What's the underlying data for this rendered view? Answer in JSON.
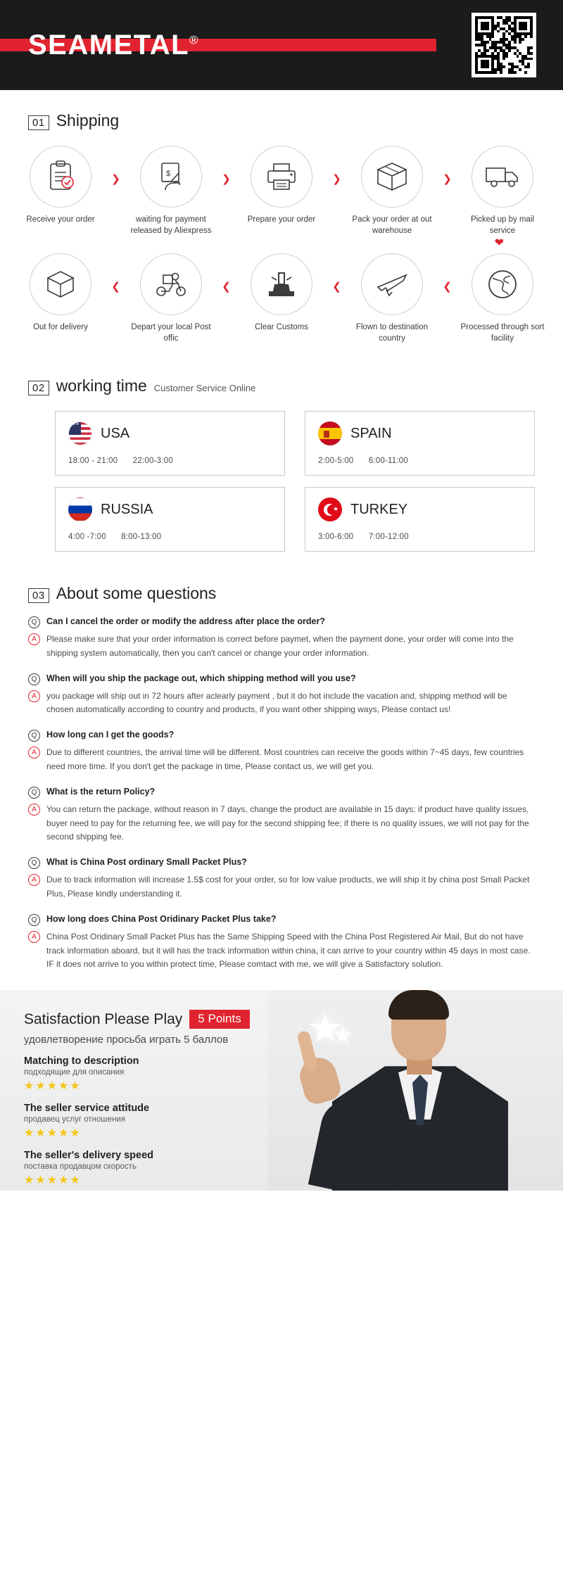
{
  "header": {
    "brand": "SEAMETAL",
    "registered_mark": "®",
    "qr_label": "qr-code"
  },
  "sections": {
    "shipping": {
      "number": "01",
      "title": "Shipping"
    },
    "working_time": {
      "number": "02",
      "title": "working time",
      "subtitle": "Customer Service Online"
    },
    "faq": {
      "number": "03",
      "title": "About some questions"
    }
  },
  "shipping_steps_row1": [
    {
      "icon": "clipboard-check-icon",
      "label": "Receive your order"
    },
    {
      "icon": "payment-hand-icon",
      "label": "waiting for payment released by Aliexpress"
    },
    {
      "icon": "printer-icon",
      "label": "Prepare your order"
    },
    {
      "icon": "box-icon",
      "label": "Pack your order at out warehouse"
    },
    {
      "icon": "truck-icon",
      "label": "Picked up by mail service"
    }
  ],
  "shipping_steps_row2": [
    {
      "icon": "open-box-icon",
      "label": "Out  for delivery"
    },
    {
      "icon": "scooter-delivery-icon",
      "label": "Depart your local Post offic"
    },
    {
      "icon": "customs-stamp-icon",
      "label": "Clear Customs"
    },
    {
      "icon": "airplane-icon",
      "label": "Flown to destination country"
    },
    {
      "icon": "globe-icon",
      "label": "Processed through sort facility"
    }
  ],
  "working_time_cards": [
    {
      "flag": "flag-usa-icon",
      "country": "USA",
      "times": [
        "18:00 - 21:00",
        "22:00-3:00"
      ]
    },
    {
      "flag": "flag-spain-icon",
      "country": "SPAIN",
      "times": [
        "2:00-5:00",
        "6:00-11:00"
      ]
    },
    {
      "flag": "flag-russia-icon",
      "country": "RUSSIA",
      "times": [
        "4:00 -7:00",
        "8:00-13:00"
      ]
    },
    {
      "flag": "flag-turkey-icon",
      "country": "TURKEY",
      "times": [
        "3:00-6:00",
        "7:00-12:00"
      ]
    }
  ],
  "faq": [
    {
      "q_badge": "Q",
      "a_badge": "A",
      "question": "Can I cancel the order or modify the address after place the order?",
      "answer": "Please make sure that your order information is correct before paymet, when the payment done, your order will come into the shipping system automatically, then you can't cancel or change your order information."
    },
    {
      "q_badge": "Q",
      "a_badge": "A",
      "question": "When will you ship the package out, which shipping method will you use?",
      "answer": "you package will ship out in 72 hours after aclearly payment , but it do hot include the vacation and, shipping method will be chosen automatically according to country and products, if you want other shipping ways, Please contact us!"
    },
    {
      "q_badge": "Q",
      "a_badge": "A",
      "question": "How long can I get the goods?",
      "answer": "Due to different countries, the arrival time will be different. Most countries can receive the goods within 7~45 days, few countries need more time. If you don't get the package in time, Please contact us, we will get you."
    },
    {
      "q_badge": "Q",
      "a_badge": "A",
      "question": "What is the return Policy?",
      "answer": "You can return the package, without reason in 7 days, change the product are available in 15 days; if product have quality issues, buyer need to pay for the returning fee, we will pay for the second shipping fee; if there is no quality issues, we will not pay for the second shipping fee."
    },
    {
      "q_badge": "Q",
      "a_badge": "A",
      "question": "What is China Post ordinary Small Packet Plus?",
      "answer": "Due to track information will increase 1.5$ cost for your order, so for low value products, we will ship it by china post Small Packet Plus, Please kindly understanding it."
    },
    {
      "q_badge": "Q",
      "a_badge": "A",
      "question": "How long does China Post Oridinary Packet Plus take?",
      "answer": "China Post Oridinary Small Packet Plus has the Same Shipping Speed with the China Post Registered Air Mail, But do not have track information aboard, but it will has the track information within china, it can arrive to your country within 45 days in most case. IF it does not arrive to you within protect time, Please comtact with me, we will give a Satisfactory solution."
    }
  ],
  "feedback": {
    "title": "Satisfaction Please Play",
    "points_badge": "5 Points",
    "subtitle": "удовлетворение просьба играть 5 баллов",
    "ratings": [
      {
        "en": "Matching to description",
        "ru": "подходящие для описания",
        "stars": "★★★★★"
      },
      {
        "en": "The seller service attitude",
        "ru": "продавец услуг отношения",
        "stars": "★★★★★"
      },
      {
        "en": "The seller's delivery speed",
        "ru": "поставка продавцом скорость",
        "stars": "★★★★★"
      }
    ]
  },
  "colors": {
    "brand_red": "#e0232e",
    "header_black": "#1b1b1b",
    "star_yellow": "#f5c518"
  }
}
